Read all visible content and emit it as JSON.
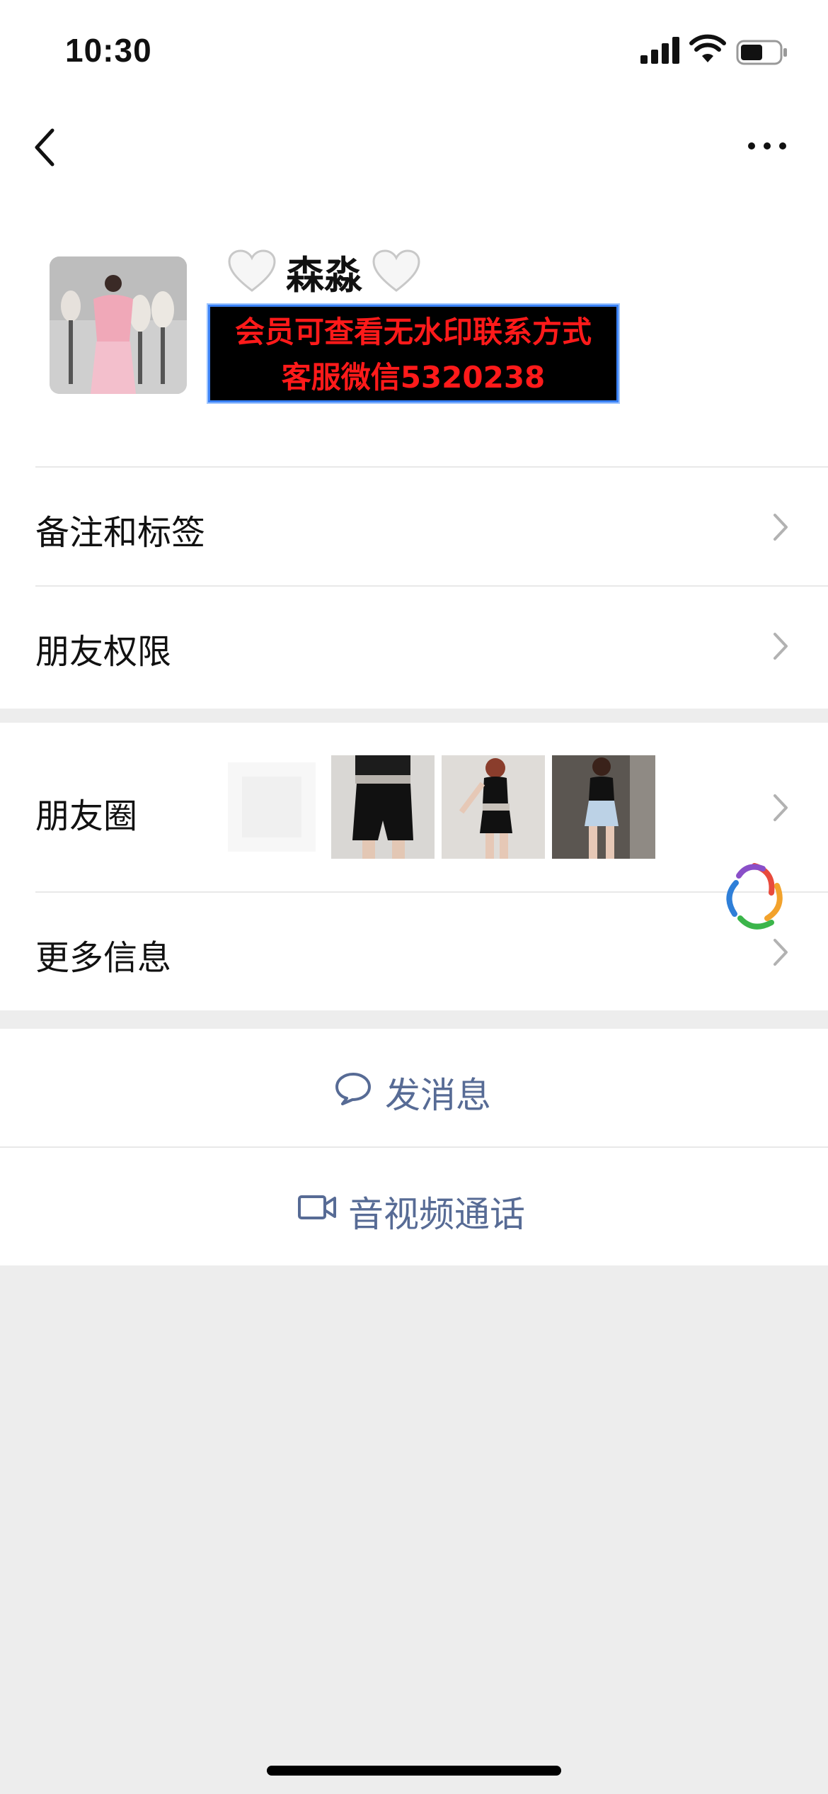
{
  "status_bar": {
    "time": "10:30"
  },
  "profile": {
    "name": "森淼",
    "promo_line1": "会员可查看无水印联系方式",
    "promo_line2": "客服微信5320238"
  },
  "menu": {
    "remark_label": "备注和标签",
    "permission_label": "朋友权限",
    "moments_label": "朋友圈",
    "more_info_label": "更多信息"
  },
  "actions": {
    "message_label": "发消息",
    "call_label": "音视频通话"
  },
  "colors": {
    "link_blue": "#576b95",
    "promo_text": "#ff1a1a",
    "background": "#ededed"
  }
}
